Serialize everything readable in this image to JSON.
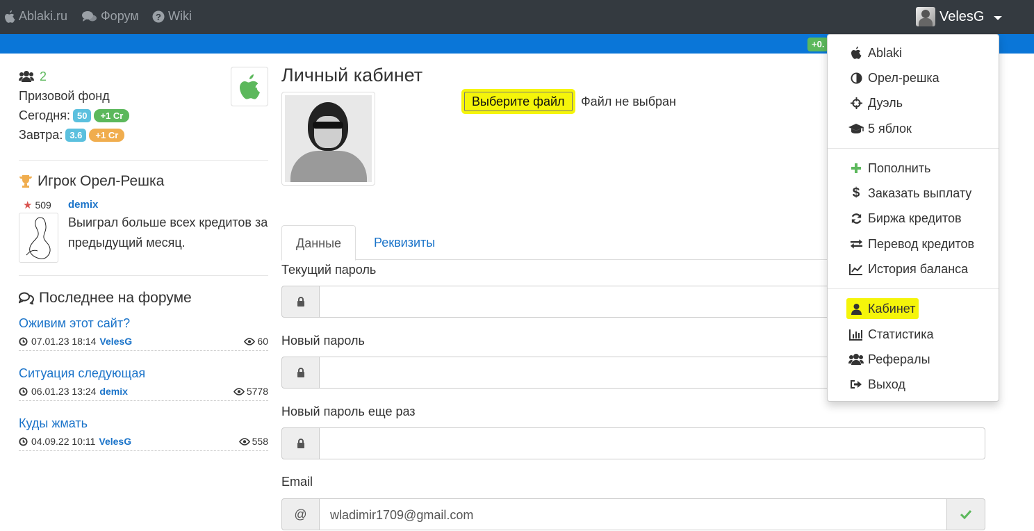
{
  "navbar": {
    "brand": "Ablaki.ru",
    "forum": "Форум",
    "wiki": "Wiki",
    "username": "VelesG"
  },
  "balance_badge": "+0.",
  "sidebar": {
    "users_online": "2",
    "prize_fund_label": "Призовой фонд",
    "today_label": "Сегодня:",
    "today_value": "50",
    "today_bonus": "+1 Cr",
    "tomorrow_label": "Завтра:",
    "tomorrow_value": "3.6",
    "tomorrow_bonus": "+1 Cr",
    "player_section_title": "Игрок Орел-Решка",
    "player": {
      "rating": "509",
      "name": "demix",
      "text": "Выиграл больше всех кредитов за предыдущий месяц."
    },
    "forum_section_title": "Последнее на форуме",
    "topics": [
      {
        "title": "Оживим этот сайт?",
        "date": "07.01.23 18:14",
        "author": "VelesG",
        "views": "60"
      },
      {
        "title": "Ситуация следующая",
        "date": "06.01.23 13:24",
        "author": "demix",
        "views": "5778"
      },
      {
        "title": "Куды жмать",
        "date": "04.09.22 10:11",
        "author": "VelesG",
        "views": "558"
      }
    ]
  },
  "main": {
    "title": "Личный кабинет",
    "file_button": "Выберите файл",
    "file_status": "Файл не выбран",
    "tabs": [
      {
        "label": "Данные",
        "active": true
      },
      {
        "label": "Реквизиты",
        "active": false
      }
    ],
    "fields": {
      "current_password_label": "Текущий пароль",
      "new_password_label": "Новый пароль",
      "repeat_password_label": "Новый пароль еще раз",
      "email_label": "Email",
      "email_value": "wladimir1709@gmail.com"
    }
  },
  "dropdown": {
    "items": [
      {
        "label": "Ablaki",
        "icon": "apple-icon"
      },
      {
        "label": "Орел-решка",
        "icon": "half-circle-icon"
      },
      {
        "label": "Дуэль",
        "icon": "crosshairs-icon"
      },
      {
        "label": "5 яблок",
        "icon": "graduation-cap-icon"
      },
      {
        "label": "Пополнить",
        "icon": "plus-icon"
      },
      {
        "label": "Заказать выплату",
        "icon": "dollar-icon"
      },
      {
        "label": "Биржа кредитов",
        "icon": "refresh-icon"
      },
      {
        "label": "Перевод кредитов",
        "icon": "transfer-icon"
      },
      {
        "label": "История баланса",
        "icon": "line-chart-icon"
      },
      {
        "label": "Кабинет",
        "icon": "user-icon",
        "highlighted": true
      },
      {
        "label": "Статистика",
        "icon": "bar-chart-icon"
      },
      {
        "label": "Рефералы",
        "icon": "users-icon"
      },
      {
        "label": "Выход",
        "icon": "sign-out-icon"
      }
    ]
  },
  "colors": {
    "navbar": "#343a40",
    "bluebar": "#0a76d8",
    "link": "#1a73c9",
    "success": "#5cb85c",
    "info": "#5bc0de",
    "warning": "#f0ad4e",
    "highlight": "#f5f50a"
  }
}
